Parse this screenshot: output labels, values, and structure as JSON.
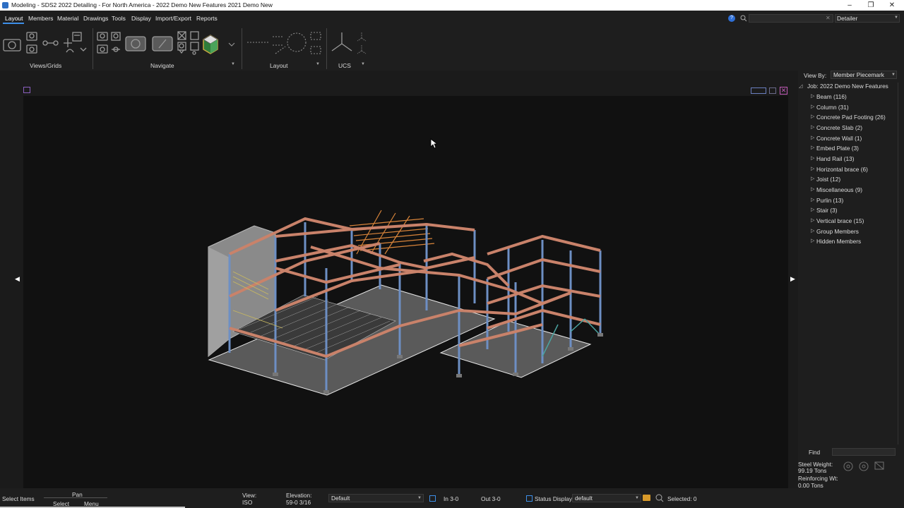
{
  "window": {
    "title": "Modeling - SDS2 2022 Detailing - For North America - 2022 Demo New Features 2021 Demo New",
    "minimize": "–",
    "restore": "❐",
    "close": "✕"
  },
  "menu": {
    "items": [
      "Layout",
      "Members",
      "Material",
      "Drawings",
      "Tools",
      "Display",
      "Import/Export",
      "Reports"
    ],
    "active": "Layout"
  },
  "topright": {
    "help_icon": "?",
    "profile": "Detailer"
  },
  "ribbon": {
    "groups": [
      {
        "label": "Views/Grids"
      },
      {
        "label": "Navigate"
      },
      {
        "label": "Layout"
      },
      {
        "label": "UCS"
      }
    ]
  },
  "panel": {
    "view_by_label": "View By:",
    "view_by_value": "Member Piecemark",
    "root": "Job: 2022 Demo New Features",
    "items": [
      "Beam (116)",
      "Column (31)",
      "Concrete Pad Footing (26)",
      "Concrete Slab (2)",
      "Concrete Wall (1)",
      "Embed Plate (3)",
      "Hand Rail (13)",
      "Horizontal brace (6)",
      "Joist (12)",
      "Miscellaneous (9)",
      "Purlin (13)",
      "Stair (3)",
      "Vertical brace (15)",
      "Group Members",
      "Hidden Members"
    ],
    "find_label": "Find",
    "steel_weight_label": "Steel Weight:",
    "steel_weight_value": "99.19 Tons",
    "reinforcing_label": "Reinforcing Wt:",
    "reinforcing_value": "0.00 Tons"
  },
  "status": {
    "mode": "Select Items",
    "pan": "Pan",
    "select": "Select",
    "menu": "Menu",
    "view_label": "View:",
    "view_value": "ISO",
    "elevation_label": "Elevation:",
    "elevation_value": "59-0 3/16",
    "layer_value": "Default",
    "in_value": "In 3-0",
    "out_value": "Out 3-0",
    "status_display_label": "Status Display",
    "status_display_value": "default",
    "selected": "Selected: 0"
  },
  "colors": {
    "accent": "#3d8fe8",
    "beam": "#c9826a",
    "column": "#6d8fc4",
    "viewport_bg": "#111111"
  }
}
